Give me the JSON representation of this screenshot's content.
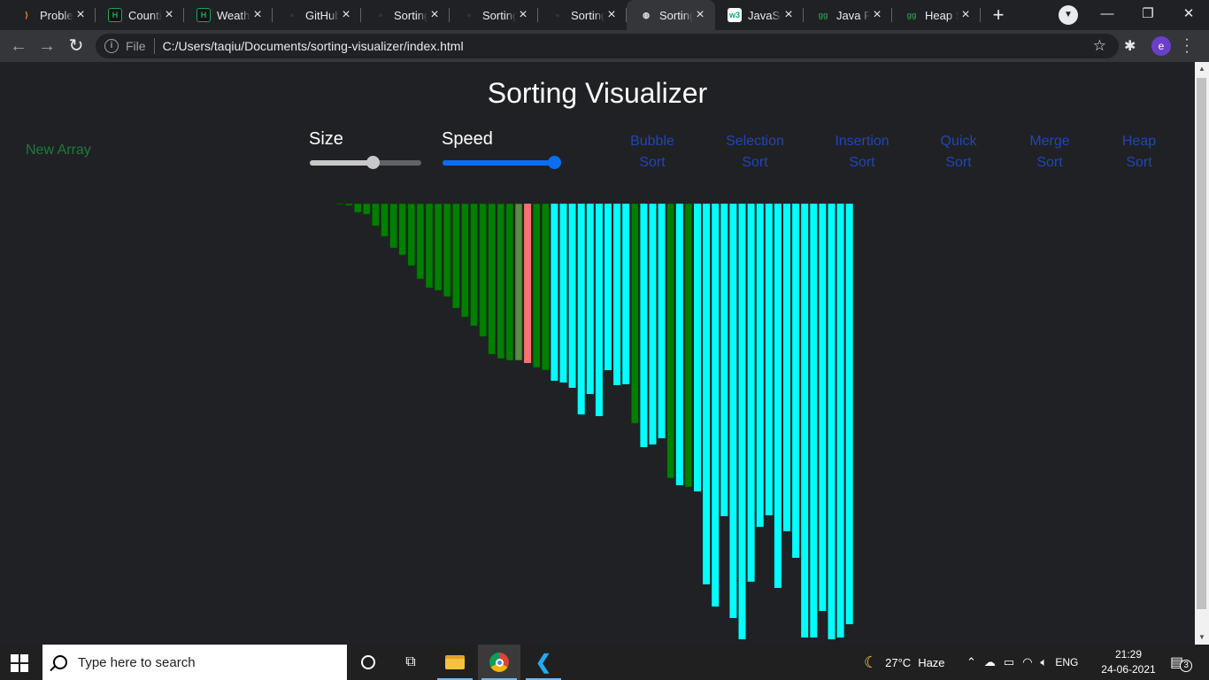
{
  "browser": {
    "tabs": [
      {
        "title": "Problem",
        "icon": "leetcode-icon",
        "color": "#f89f1b"
      },
      {
        "title": "Counting",
        "icon": "hackerrank-icon",
        "color": "#1ba94c"
      },
      {
        "title": "Weather",
        "icon": "hackerrank-icon",
        "color": "#1ba94c"
      },
      {
        "title": "GitHub",
        "icon": "github-icon",
        "color": "#333333"
      },
      {
        "title": "Sorting",
        "icon": "github-icon",
        "color": "#333333"
      },
      {
        "title": "Sorting",
        "icon": "github-icon",
        "color": "#333333"
      },
      {
        "title": "Sorting",
        "icon": "github-icon",
        "color": "#333333"
      },
      {
        "title": "Sorting",
        "icon": "globe-icon",
        "color": "#e8eaed",
        "active": true
      },
      {
        "title": "JavaScript",
        "icon": "w3schools-icon",
        "color": "#ffffff"
      },
      {
        "title": "Java Program",
        "icon": "geeksforgeeks-icon",
        "color": "#2f8d46"
      },
      {
        "title": "Heap Sort",
        "icon": "geeksforgeeks-icon",
        "color": "#2f8d46"
      }
    ],
    "new_tab": "+",
    "address": {
      "scheme_label": "File",
      "url": "C:/Users/taqiu/Documents/sorting-visualizer/index.html"
    },
    "profile_initial": "e"
  },
  "page": {
    "title": "Sorting Visualizer",
    "new_array_label": "New Array",
    "size_label": "Size",
    "speed_label": "Speed",
    "size_value": 0.56,
    "speed_value": 1.0,
    "algorithms": [
      {
        "line1": "Bubble",
        "line2": "Sort"
      },
      {
        "line1": "Selection",
        "line2": "Sort"
      },
      {
        "line1": "Insertion",
        "line2": "Sort"
      },
      {
        "line1": "Quick",
        "line2": "Sort"
      },
      {
        "line1": "Merge",
        "line2": "Sort"
      },
      {
        "line1": "Heap",
        "line2": "Sort"
      }
    ],
    "colors": {
      "sorted": "#008000",
      "unsorted": "#00ffff",
      "compare": "#5c8a47",
      "swap": "#ff7070",
      "accent": "#0b6ef0",
      "algo_text": "#1f46b8",
      "new_array_text": "#1e7a3c"
    },
    "bars": {
      "heights": [
        1,
        2,
        10,
        12,
        25,
        37,
        50,
        58,
        70,
        85,
        95,
        98,
        105,
        118,
        128,
        138,
        150,
        170,
        175,
        177,
        177,
        180,
        185,
        188,
        200,
        202,
        208,
        238,
        215,
        240,
        188,
        205,
        204,
        248,
        275,
        272,
        265,
        310,
        318,
        320,
        325,
        430,
        455,
        353,
        468,
        492,
        427,
        365,
        352,
        434,
        370,
        400,
        490,
        490,
        460,
        492,
        490,
        475
      ],
      "states": [
        "s",
        "s",
        "s",
        "s",
        "s",
        "s",
        "s",
        "s",
        "s",
        "s",
        "s",
        "s",
        "s",
        "s",
        "s",
        "s",
        "s",
        "s",
        "s",
        "s",
        "c",
        "w",
        "s",
        "s",
        "u",
        "u",
        "u",
        "u",
        "u",
        "u",
        "u",
        "u",
        "u",
        "s",
        "u",
        "u",
        "u",
        "s",
        "u",
        "s",
        "u",
        "u",
        "u",
        "u",
        "u",
        "u",
        "u",
        "u",
        "u",
        "u",
        "u",
        "u",
        "u",
        "u",
        "u",
        "u",
        "u",
        "u"
      ]
    }
  },
  "taskbar": {
    "search_placeholder": "Type here to search",
    "weather_temp": "27°C",
    "weather_desc": "Haze",
    "language": "ENG",
    "time": "21:29",
    "date": "24-06-2021",
    "notifications": "3"
  }
}
